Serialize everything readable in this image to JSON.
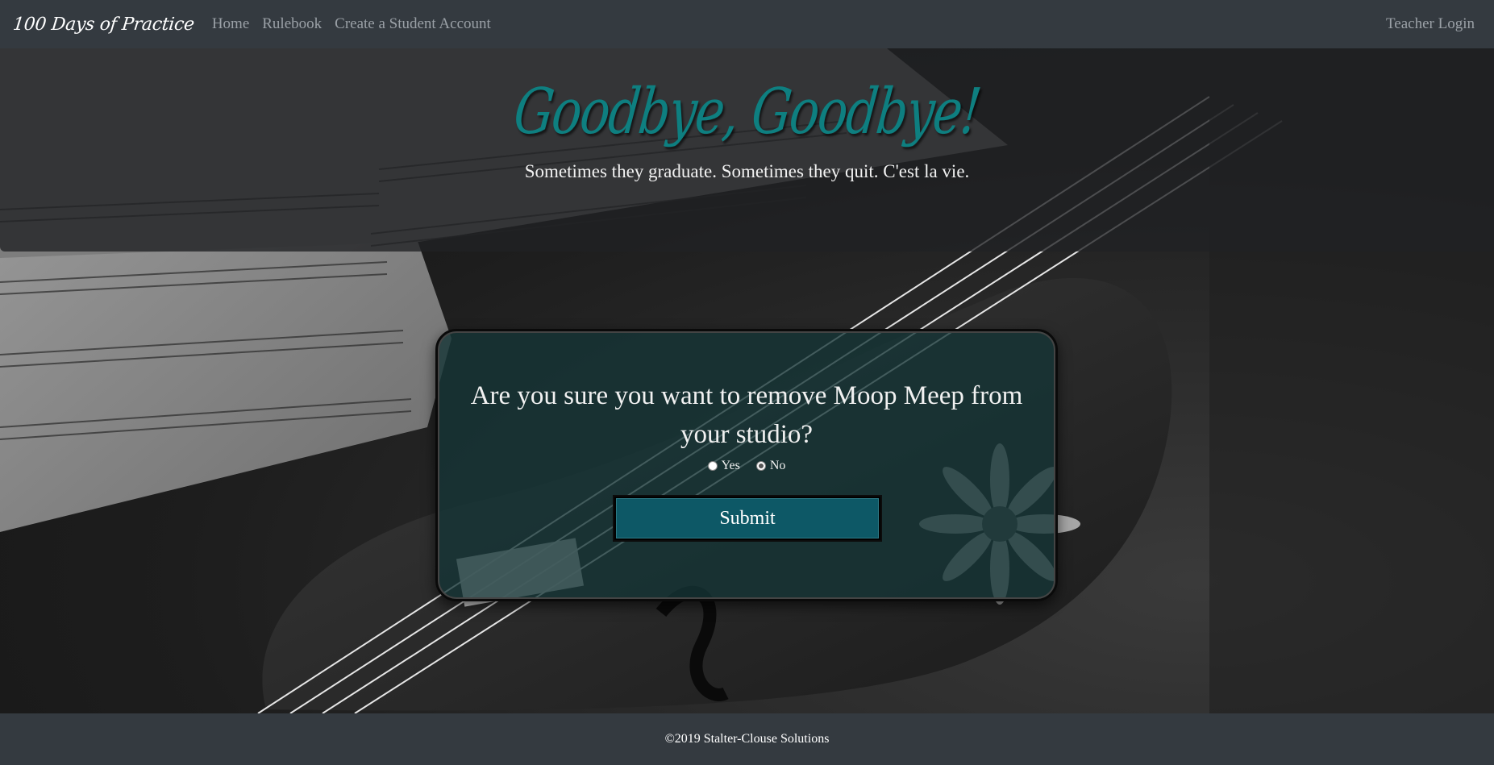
{
  "navbar": {
    "brand": "100 Days of Practice",
    "links": [
      {
        "label": "Home"
      },
      {
        "label": "Rulebook"
      },
      {
        "label": "Create a Student Account"
      }
    ],
    "right_link": "Teacher Login"
  },
  "jumbotron": {
    "title": "Goodbye, Goodbye!",
    "subtitle": "Sometimes they graduate. Sometimes they quit. C'est la vie."
  },
  "dialog": {
    "question": "Are you sure you want to remove Moop Meep from your studio?",
    "options": [
      {
        "label": "Yes",
        "checked": false
      },
      {
        "label": "No",
        "checked": true
      }
    ],
    "submit_label": "Submit"
  },
  "footer": {
    "text": "©2019 Stalter-Clouse Solutions"
  },
  "colors": {
    "navbar": "#343a40",
    "title": "#0e7f80",
    "card": "#153436",
    "button": "#0d5866"
  }
}
